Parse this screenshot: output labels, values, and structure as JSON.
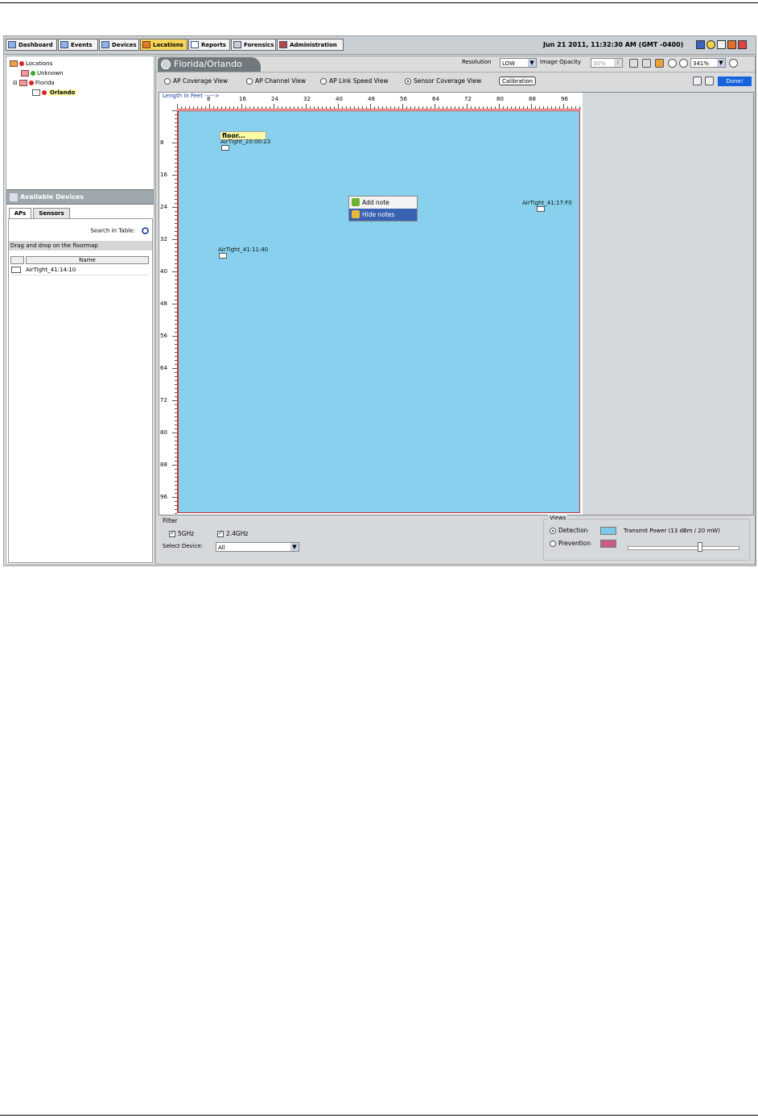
{
  "nav": {
    "tabs": [
      "Dashboard",
      "Events",
      "Devices",
      "Locations",
      "Reports",
      "Forensics",
      "Administration"
    ],
    "active": "Locations",
    "datetime": "Jun 21 2011, 11:32:30 AM (GMT -0400)"
  },
  "tree": {
    "root": "Locations",
    "unknown": "Unknown",
    "florida": "Florida",
    "orlando": "Orlando"
  },
  "available": {
    "title": "Available Devices",
    "tabs": [
      "APs",
      "Sensors"
    ],
    "search_label": "Search in Table:",
    "drag_msg": "Drag and drop on the floormap",
    "col_name": "Name",
    "rows": [
      "AirTight_41:14:10"
    ]
  },
  "header": {
    "tab_title": "Florida/Orlando",
    "resolution_label": "Resolution",
    "resolution_value": "LOW",
    "opacity_label": "Image Opacity",
    "opacity_value": "30%",
    "zoom_value": "341%"
  },
  "views": {
    "options": [
      "AP Coverage View",
      "AP Channel View",
      "AP Link Speed View",
      "Sensor Coverage View"
    ],
    "selected": "Sensor Coverage View",
    "calibration": "Calibration",
    "done": "Done!"
  },
  "floor": {
    "length_label": "Length in  Feet ----->",
    "x_ticks": [
      "8",
      "16",
      "24",
      "32",
      "40",
      "48",
      "56",
      "64",
      "72",
      "80",
      "88",
      "96"
    ],
    "y_ticks": [
      "8",
      "16",
      "24",
      "32",
      "40",
      "48",
      "56",
      "64",
      "72",
      "80",
      "88",
      "96"
    ],
    "note": "floor...",
    "devices": [
      "AirTight_20:00:23",
      "AirTight_41:17:F0",
      "AirTight_41:11:40"
    ],
    "context_menu": [
      "Add note",
      "Hide notes"
    ],
    "floor_color": "#87d1ee"
  },
  "filter": {
    "title": "Filter",
    "bands": [
      "5GHz",
      "2.4GHz"
    ],
    "select_device_label": "Select Device:",
    "select_device_value": "All"
  },
  "views_panel": {
    "title": "Views",
    "detection": "Detection",
    "prevention": "Prevention",
    "detection_color": "#7fc9ea",
    "prevention_color": "#c65c8a",
    "transmit_power": "Transmit Power  (13 dBm /  20 mW)",
    "transmit_level": 0.65
  }
}
